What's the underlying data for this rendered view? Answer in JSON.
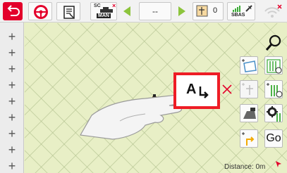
{
  "topbar": {
    "back_icon": "back-arrow-icon",
    "steering_icon": "steering-wheel-icon",
    "document_icon": "document-icon",
    "section_control": {
      "label_top": "SC",
      "label_bottom": "MAN"
    },
    "track_selector": {
      "value": "--"
    },
    "counter": {
      "value": "0"
    },
    "gnss": {
      "label": "SBAS"
    },
    "colors": {
      "brand_red": "#e3002b",
      "nav_green": "#8cc43c",
      "section_yellow": "#f2d100",
      "section_green": "#3aaa35"
    }
  },
  "sidebar": {
    "items": [
      {
        "label": "+"
      },
      {
        "label": "+"
      },
      {
        "label": "+"
      },
      {
        "label": "+"
      },
      {
        "label": "+"
      },
      {
        "label": "+"
      },
      {
        "label": "+"
      },
      {
        "label": "+"
      },
      {
        "label": "+"
      }
    ]
  },
  "tools": {
    "zoom_icon": "magnifier-icon",
    "abline_icon": "a-arrow-icon",
    "delete_icon": "close-icon",
    "go_label": "Go"
  },
  "status": {
    "distance": "Distance: 0m"
  }
}
